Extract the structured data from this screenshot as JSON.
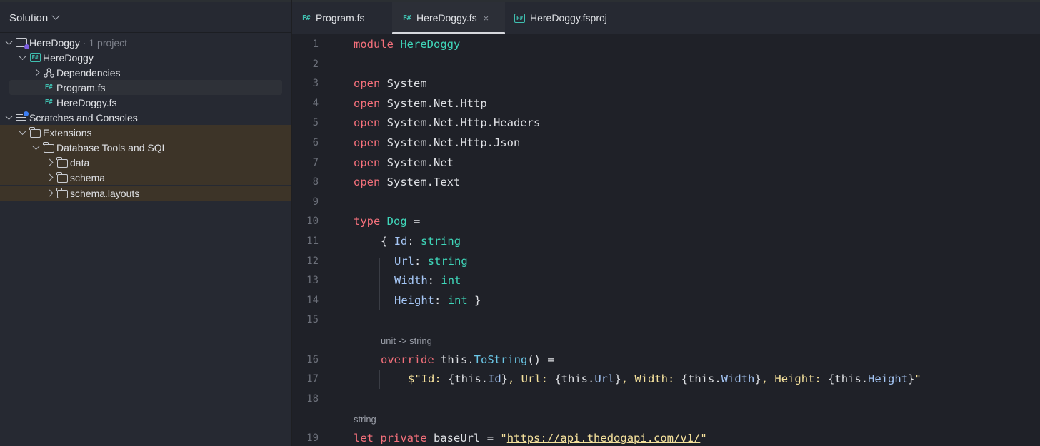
{
  "sidebar": {
    "title": "Solution",
    "tree": [
      {
        "label": "HereDoggy",
        "suffix": "· 1 project"
      },
      {
        "label": "HereDoggy"
      },
      {
        "label": "Dependencies"
      },
      {
        "label": "Program.fs"
      },
      {
        "label": "HereDoggy.fs"
      },
      {
        "label": "Scratches and Consoles"
      },
      {
        "label": "Extensions"
      },
      {
        "label": "Database Tools and SQL"
      },
      {
        "label": "data"
      },
      {
        "label": "schema"
      },
      {
        "label": "schema.layouts"
      }
    ]
  },
  "tabs": [
    {
      "label": "Program.fs",
      "icon": "F#"
    },
    {
      "label": "HereDoggy.fs",
      "icon": "F#",
      "close": "×"
    },
    {
      "label": "HereDoggy.fsproj",
      "icon": "F#"
    }
  ],
  "editor": {
    "line_numbers": [
      "1",
      "2",
      "3",
      "4",
      "5",
      "6",
      "7",
      "8",
      "9",
      "10",
      "11",
      "12",
      "13",
      "14",
      "15",
      "16",
      "17",
      "18",
      "19"
    ],
    "hints": {
      "override_type": "unit -> string",
      "baseurl_type": "string"
    },
    "code": {
      "l1": [
        "module",
        "HereDoggy"
      ],
      "l3": [
        "open",
        "System"
      ],
      "l4": [
        "open",
        "System.Net.Http"
      ],
      "l5": [
        "open",
        "System.Net.Http.Headers"
      ],
      "l6": [
        "open",
        "System.Net.Http.Json"
      ],
      "l7": [
        "open",
        "System.Net"
      ],
      "l8": [
        "open",
        "System.Text"
      ],
      "l10": [
        "type",
        "Dog",
        "="
      ],
      "l11": [
        "{",
        "Id",
        ":",
        "string"
      ],
      "l12": [
        "Url",
        ":",
        "string"
      ],
      "l13": [
        "Width",
        ":",
        "int"
      ],
      "l14": [
        "Height",
        ":",
        "int",
        "}"
      ],
      "l16": [
        "override",
        "this.",
        "ToString",
        "() ="
      ],
      "l17": [
        "$\"Id: ",
        "{this.",
        "Id",
        "}",
        ", Url: ",
        "{this.",
        "Url",
        "}",
        ", Width: ",
        "{this.",
        "Width",
        "}",
        ", Height: ",
        "{this.",
        "Height",
        "}",
        "\""
      ],
      "l19": [
        "let",
        "private",
        "baseUrl",
        "=",
        "\"",
        "https://api.thedogapi.com/v1/",
        "\""
      ]
    }
  }
}
